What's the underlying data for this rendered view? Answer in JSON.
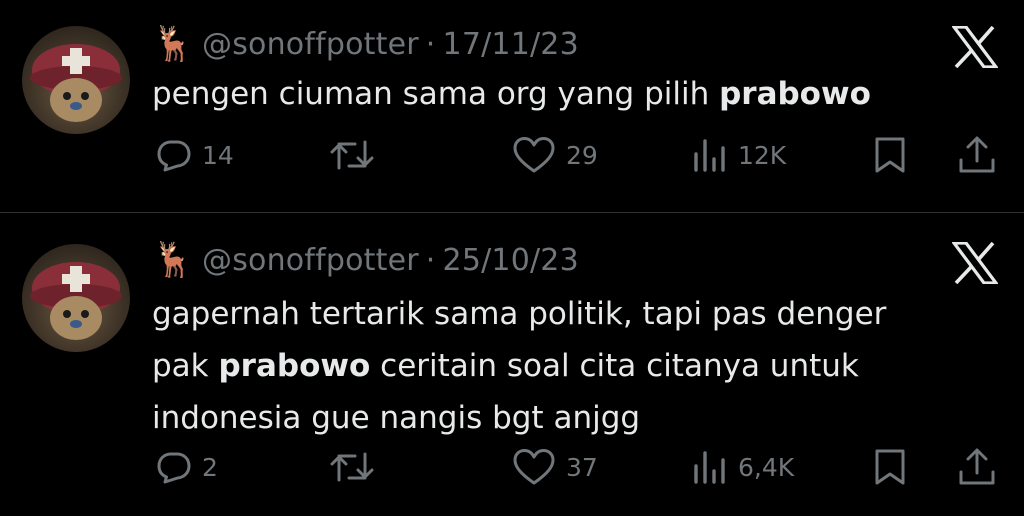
{
  "tweets": [
    {
      "emoji": "🦌",
      "handle": "@sonoffpotter",
      "separator": "·",
      "date": "17/11/23",
      "text_before": "pengen ciuman sama org yang pilih ",
      "highlight": "prabowo",
      "text_after": "",
      "replies": "14",
      "retweets": "",
      "likes": "29",
      "views": "12K"
    },
    {
      "emoji": "🦌",
      "handle": "@sonoffpotter",
      "separator": "·",
      "date": "25/10/23",
      "text_before": "gapernah tertarik sama politik, tapi pas denger\npak ",
      "highlight": "prabowo",
      "text_after": " ceritain soal cita citanya untuk\nindonesia gue nangis bgt anjgg",
      "replies": "2",
      "retweets": "",
      "likes": "37",
      "views": "6,4K"
    }
  ],
  "icons": {
    "logo": "x-logo-icon",
    "reply": "reply-icon",
    "retweet": "retweet-icon",
    "like": "heart-icon",
    "views": "views-icon",
    "bookmark": "bookmark-icon",
    "share": "share-icon"
  },
  "colors": {
    "background": "#000000",
    "text": "#e7e9ea",
    "secondary": "#71767b",
    "divider": "#2f3336"
  }
}
